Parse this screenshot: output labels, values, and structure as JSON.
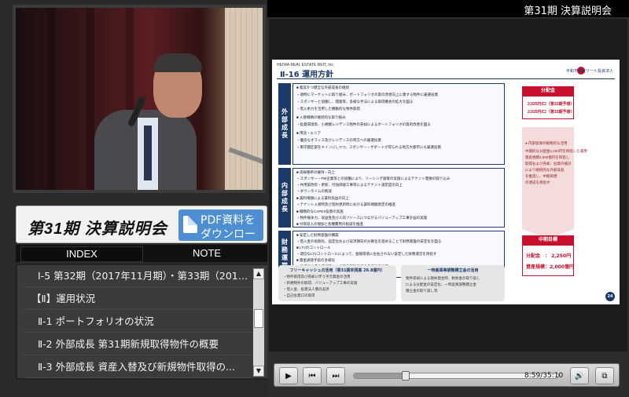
{
  "header": {
    "title": "第31期 決算説明会"
  },
  "banner": {
    "title": "第31期  決算説明会",
    "pdf_line1": "PDF資料を",
    "pdf_line2": "ダウンロード"
  },
  "tabs": {
    "index": "INDEX",
    "note": "NOTE"
  },
  "index_items": [
    "Ⅰ-5 第32期（2017年11月期）・第33期（2018年...",
    "【Ⅱ】運用状況",
    "Ⅱ-1 ポートフォリオの状況",
    "Ⅱ-2 外部成長 第31期新規取得物件の概要",
    "Ⅱ-3 外部成長 資産入替及び新規物件取得の..."
  ],
  "slide": {
    "company": "HEIWA REAL ESTATE REIT, Inc.",
    "title": "Ⅱ-16  運用方針",
    "logo_text": "平和不動産リート投資法人",
    "sections": [
      {
        "label": "外部成長",
        "bullets": [
          "■ 着実かつ健全な外部成長の継続",
          "・適時にマーケットに取り組み、ポートフォリオの質の改善向上に資する物件に厳選投資",
          "・スポンサーと協働し、開発等、多様な手法による取得機会の拡大を図る",
          "・借入余力を活用した機動的な物件取得",
          "■ 入替戦略の継続的な取り組み",
          "・投資環境等、小規模レジデンス物件の売却によるポートフォリオの質的改善を図る",
          "■ 用途・エリア",
          "・優良なオフィス及びレジデンスの両方への厳選投資",
          "・東京都区部をメインにしつつ、スポンサー・サポートが得られる地方大都市にも厳選投資"
        ]
      },
      {
        "label": "内部成長",
        "bullets": [
          "■ 高稼働率の維持・向上",
          "・スポンサー・PM企業等との協働により、リーシング施策の実施によるテナント需要の取り込み",
          "・共用部改装・更新、付加価値工事等によるテナント満足度の向上",
          "・ダウンタイムの削減",
          "■ 賃料増額による賃料収益の向上",
          "・テナント入替時及び契約更新時における賃料増額改定の推進",
          "■ 戦略的なCAPEX投資の実施",
          "・物件競争力、収益性及び人的リソースにつながるバリューアップ工事計画の実施",
          "■ 付帯収入の増加と各種費用の削減を推進"
        ]
      },
      {
        "label": "財務運営",
        "bullets": [
          "■ 安定した財務基盤の構築",
          "・借入金の長期化、固定化および返済期日の分散化を進めることで財務基盤の安定化を図る",
          "■ LTVのコントロール",
          "・適切なLTVコントロールによって、金融環境に左右されない安定した財務運営を目指す",
          "■ 資金調達手段の多様化",
          "・投資法人債の発行等による資金調達手段の多様化を推進",
          "■ 金融コストの低減"
        ]
      }
    ],
    "distribution_head": "分配金",
    "distribution_lines": [
      "2,025円/口（第32期予想）",
      "2,025円/口（第33期予想）"
    ],
    "arrow_lines": [
      "● 内部留保の戦略的な活用",
      "中期的な分配金2,250円を目指した運用",
      "資産規模2,000億円を目指し",
      "取得および売却、投資の検討",
      "により継続的な外部成長",
      "を推進し、中期目標",
      "の達成を目指す"
    ],
    "target_head": "中期目標",
    "target_lines": [
      "分配金　： 2,250円",
      "資産規模：2,000億円"
    ],
    "box1_head": "フリーキャッシュの活用（第31期末残高 26.8億円）",
    "box1_lines": [
      "・物件取得及び売却に伴う手元資金の活用",
      "・新規物件の取得、バリューアップ工事の実施",
      "・借入金、投資法人債の返済",
      "・自己投資口の取得"
    ],
    "box2_head": "一時差異等調整積立金の活用",
    "box2_lines": [
      "物件売却による損失発生時、剰余金の取り崩し",
      "による分配金の安定化、一時差異調整積立金",
      "積立金の取り崩し等"
    ],
    "page_number": "24"
  },
  "player": {
    "time": "8:59/35:10",
    "progress_fraction": 0.255
  }
}
